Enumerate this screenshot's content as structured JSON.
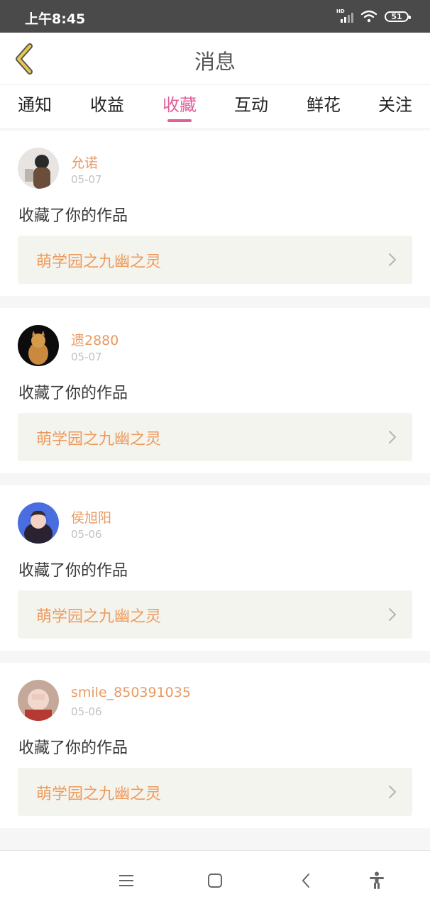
{
  "status_bar": {
    "time": "上午8:45",
    "hd": "HD",
    "battery": "51"
  },
  "header": {
    "title": "消息",
    "back_icon": "chevron-left-icon"
  },
  "tabs": [
    {
      "label": "通知"
    },
    {
      "label": "收益"
    },
    {
      "label": "收藏",
      "active": true
    },
    {
      "label": "互动"
    },
    {
      "label": "鲜花"
    },
    {
      "label": "关注"
    }
  ],
  "messages": [
    {
      "username": "允诺",
      "date": "05-07",
      "action": "收藏了你的作品",
      "work_title": "萌学园之九幽之灵"
    },
    {
      "username": "遗2880",
      "date": "05-07",
      "action": "收藏了你的作品",
      "work_title": "萌学园之九幽之灵"
    },
    {
      "username": "侯旭阳",
      "date": "05-06",
      "action": "收藏了你的作品",
      "work_title": "萌学园之九幽之灵"
    },
    {
      "username": "smile_850391035",
      "date": "05-06",
      "action": "收藏了你的作品",
      "work_title": "萌学园之九幽之灵"
    }
  ],
  "bottom_nav": [
    "menu-icon",
    "home-square-icon",
    "back-triangle-icon",
    "accessibility-icon"
  ],
  "colors": {
    "accent": "#e0609a",
    "username": "#e89a62",
    "work_title": "#ee9a5c",
    "back_icon": "#e8c84a"
  }
}
